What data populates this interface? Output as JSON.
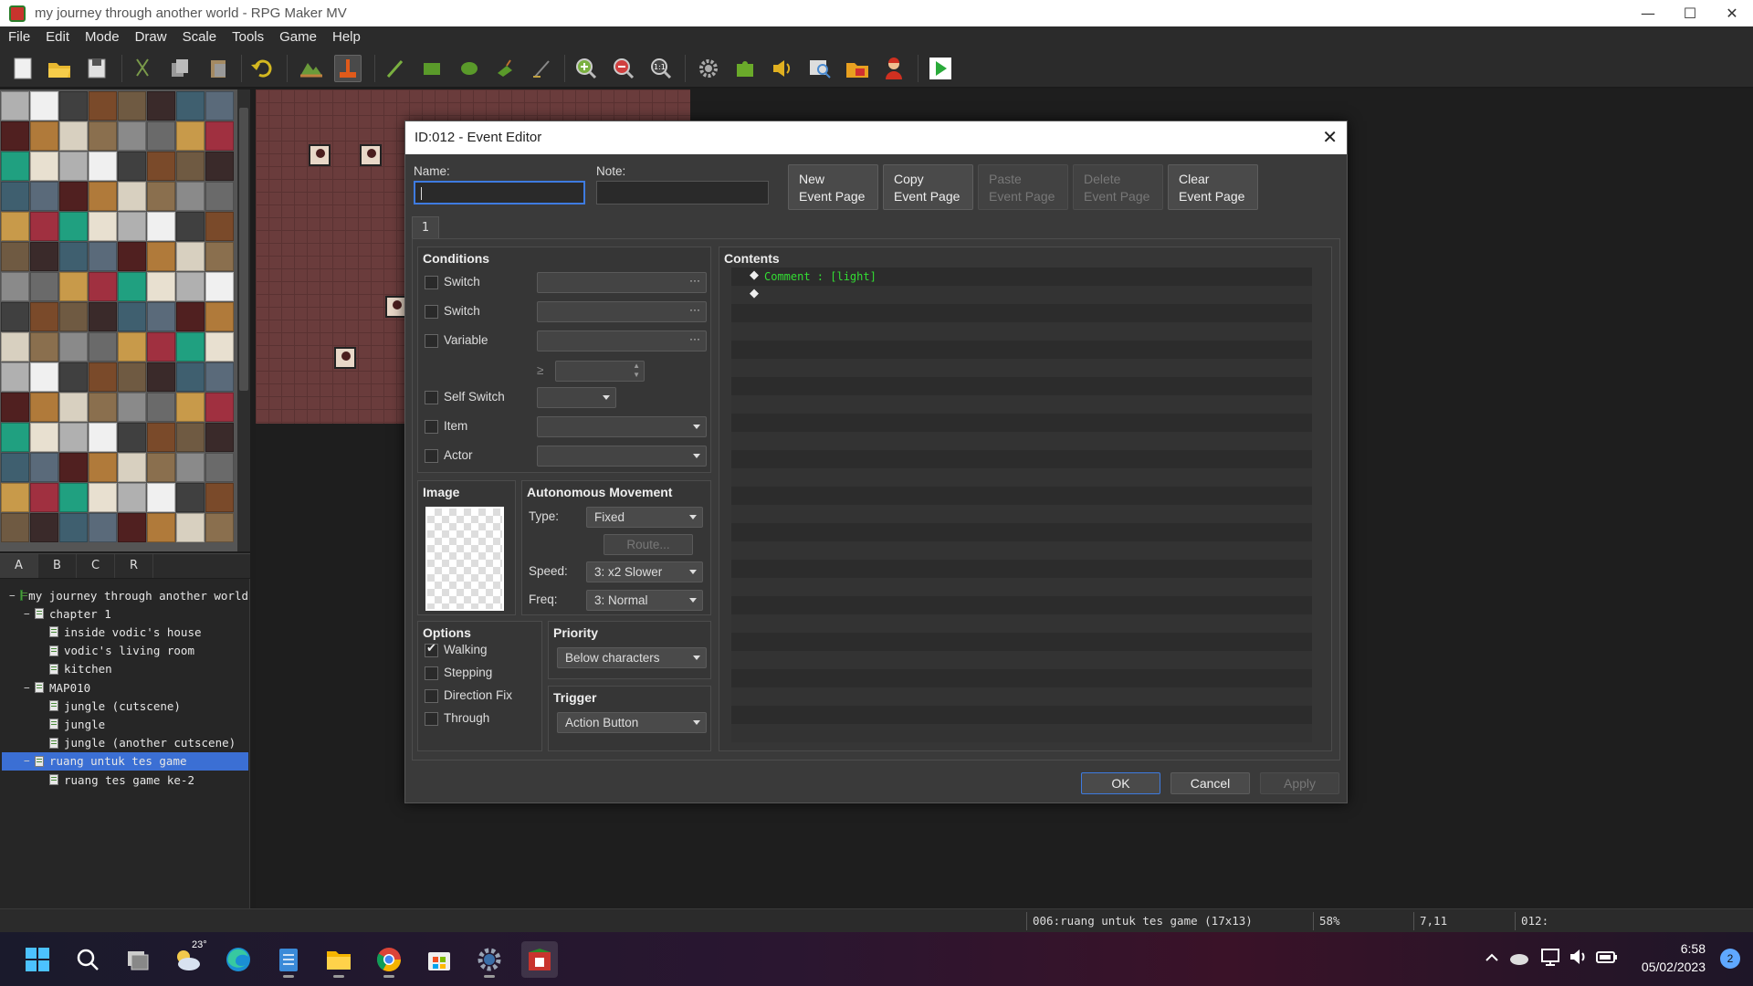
{
  "window": {
    "title": "my journey through another world - RPG Maker MV",
    "minimize": "—",
    "maximize": "☐",
    "close": "✕"
  },
  "menu": [
    "File",
    "Edit",
    "Mode",
    "Draw",
    "Scale",
    "Tools",
    "Game",
    "Help"
  ],
  "toolbar": {
    "icons": [
      "new-project-icon",
      "open-project-icon",
      "save-project-icon",
      "cut-icon",
      "copy-icon",
      "paste-icon",
      "undo-icon",
      "map-mode-icon",
      "event-mode-icon",
      "pencil-icon",
      "rectangle-icon",
      "ellipse-icon",
      "flood-fill-icon",
      "shadow-pen-icon",
      "zoom-in-icon",
      "zoom-out-icon",
      "actual-size-icon",
      "database-icon",
      "plugin-manager-icon",
      "sound-test-icon",
      "event-searcher-icon",
      "resource-manager-icon",
      "character-generator-icon",
      "playtest-icon"
    ],
    "active": "event-mode-icon"
  },
  "tile_tabs": [
    "A",
    "B",
    "C",
    "R"
  ],
  "tile_tab_selected": "A",
  "map_tree": [
    {
      "label": "my journey through another world",
      "level": 0,
      "type": "project",
      "expander": "−"
    },
    {
      "label": "chapter 1",
      "level": 1,
      "type": "map",
      "expander": "−"
    },
    {
      "label": "inside vodic's house",
      "level": 2,
      "type": "map"
    },
    {
      "label": "vodic's living room",
      "level": 2,
      "type": "map"
    },
    {
      "label": "kitchen",
      "level": 2,
      "type": "map"
    },
    {
      "label": "MAP010",
      "level": 1,
      "type": "map",
      "expander": "−"
    },
    {
      "label": "jungle (cutscene)",
      "level": 2,
      "type": "map"
    },
    {
      "label": "jungle",
      "level": 2,
      "type": "map"
    },
    {
      "label": "jungle (another cutscene)",
      "level": 2,
      "type": "map"
    },
    {
      "label": "ruang untuk tes game",
      "level": 1,
      "type": "map",
      "expander": "−",
      "selected": true
    },
    {
      "label": "ruang tes game ke-2",
      "level": 2,
      "type": "map"
    }
  ],
  "status": {
    "map": "006:ruang untuk tes game (17x13)",
    "zoom": "58%",
    "coords": "7,11",
    "event": "012:"
  },
  "taskbar": {
    "weather_temp": "23°",
    "time": "6:58",
    "date": "05/02/2023",
    "notifications": "2",
    "apps": [
      "start-icon",
      "search-icon",
      "task-view-icon",
      "weather-icon",
      "edge-icon",
      "notepad-icon",
      "file-explorer-icon",
      "chrome-icon",
      "store-icon",
      "settings-icon",
      "rpg-maker-icon"
    ],
    "tray": [
      "chevron-up-icon",
      "onedrive-icon",
      "network-icon",
      "volume-icon",
      "battery-icon"
    ]
  },
  "dialog": {
    "title": "ID:012 - Event Editor",
    "close": "✕",
    "name_label": "Name:",
    "name_value": "",
    "note_label": "Note:",
    "note_value": "",
    "page_buttons": [
      {
        "line1": "New",
        "line2": "Event Page",
        "enabled": true
      },
      {
        "line1": "Copy",
        "line2": "Event Page",
        "enabled": true
      },
      {
        "line1": "Paste",
        "line2": "Event Page",
        "enabled": false
      },
      {
        "line1": "Delete",
        "line2": "Event Page",
        "enabled": false
      },
      {
        "line1": "Clear",
        "line2": "Event Page",
        "enabled": true
      }
    ],
    "page_tab": "1",
    "conditions": {
      "title": "Conditions",
      "switch1": "Switch",
      "switch2": "Switch",
      "variable": "Variable",
      "gte": "≥",
      "self_switch": "Self Switch",
      "item": "Item",
      "actor": "Actor",
      "dots": "···"
    },
    "image": {
      "title": "Image"
    },
    "movement": {
      "title": "Autonomous Movement",
      "type_label": "Type:",
      "type_value": "Fixed",
      "route": "Route...",
      "speed_label": "Speed:",
      "speed_value": "3: x2 Slower",
      "freq_label": "Freq:",
      "freq_value": "3: Normal"
    },
    "options": {
      "title": "Options",
      "walking": "Walking",
      "walking_checked": true,
      "stepping": "Stepping",
      "direction_fix": "Direction Fix",
      "through": "Through"
    },
    "priority": {
      "title": "Priority",
      "value": "Below characters"
    },
    "trigger": {
      "title": "Trigger",
      "value": "Action Button"
    },
    "contents": {
      "title": "Contents",
      "lines": [
        {
          "marker": "◆",
          "text": "Comment : [light]",
          "color": "#33dd33"
        },
        {
          "marker": "◆",
          "text": "",
          "color": "#dddddd"
        }
      ]
    },
    "ok": "OK",
    "cancel": "Cancel",
    "apply": "Apply"
  }
}
